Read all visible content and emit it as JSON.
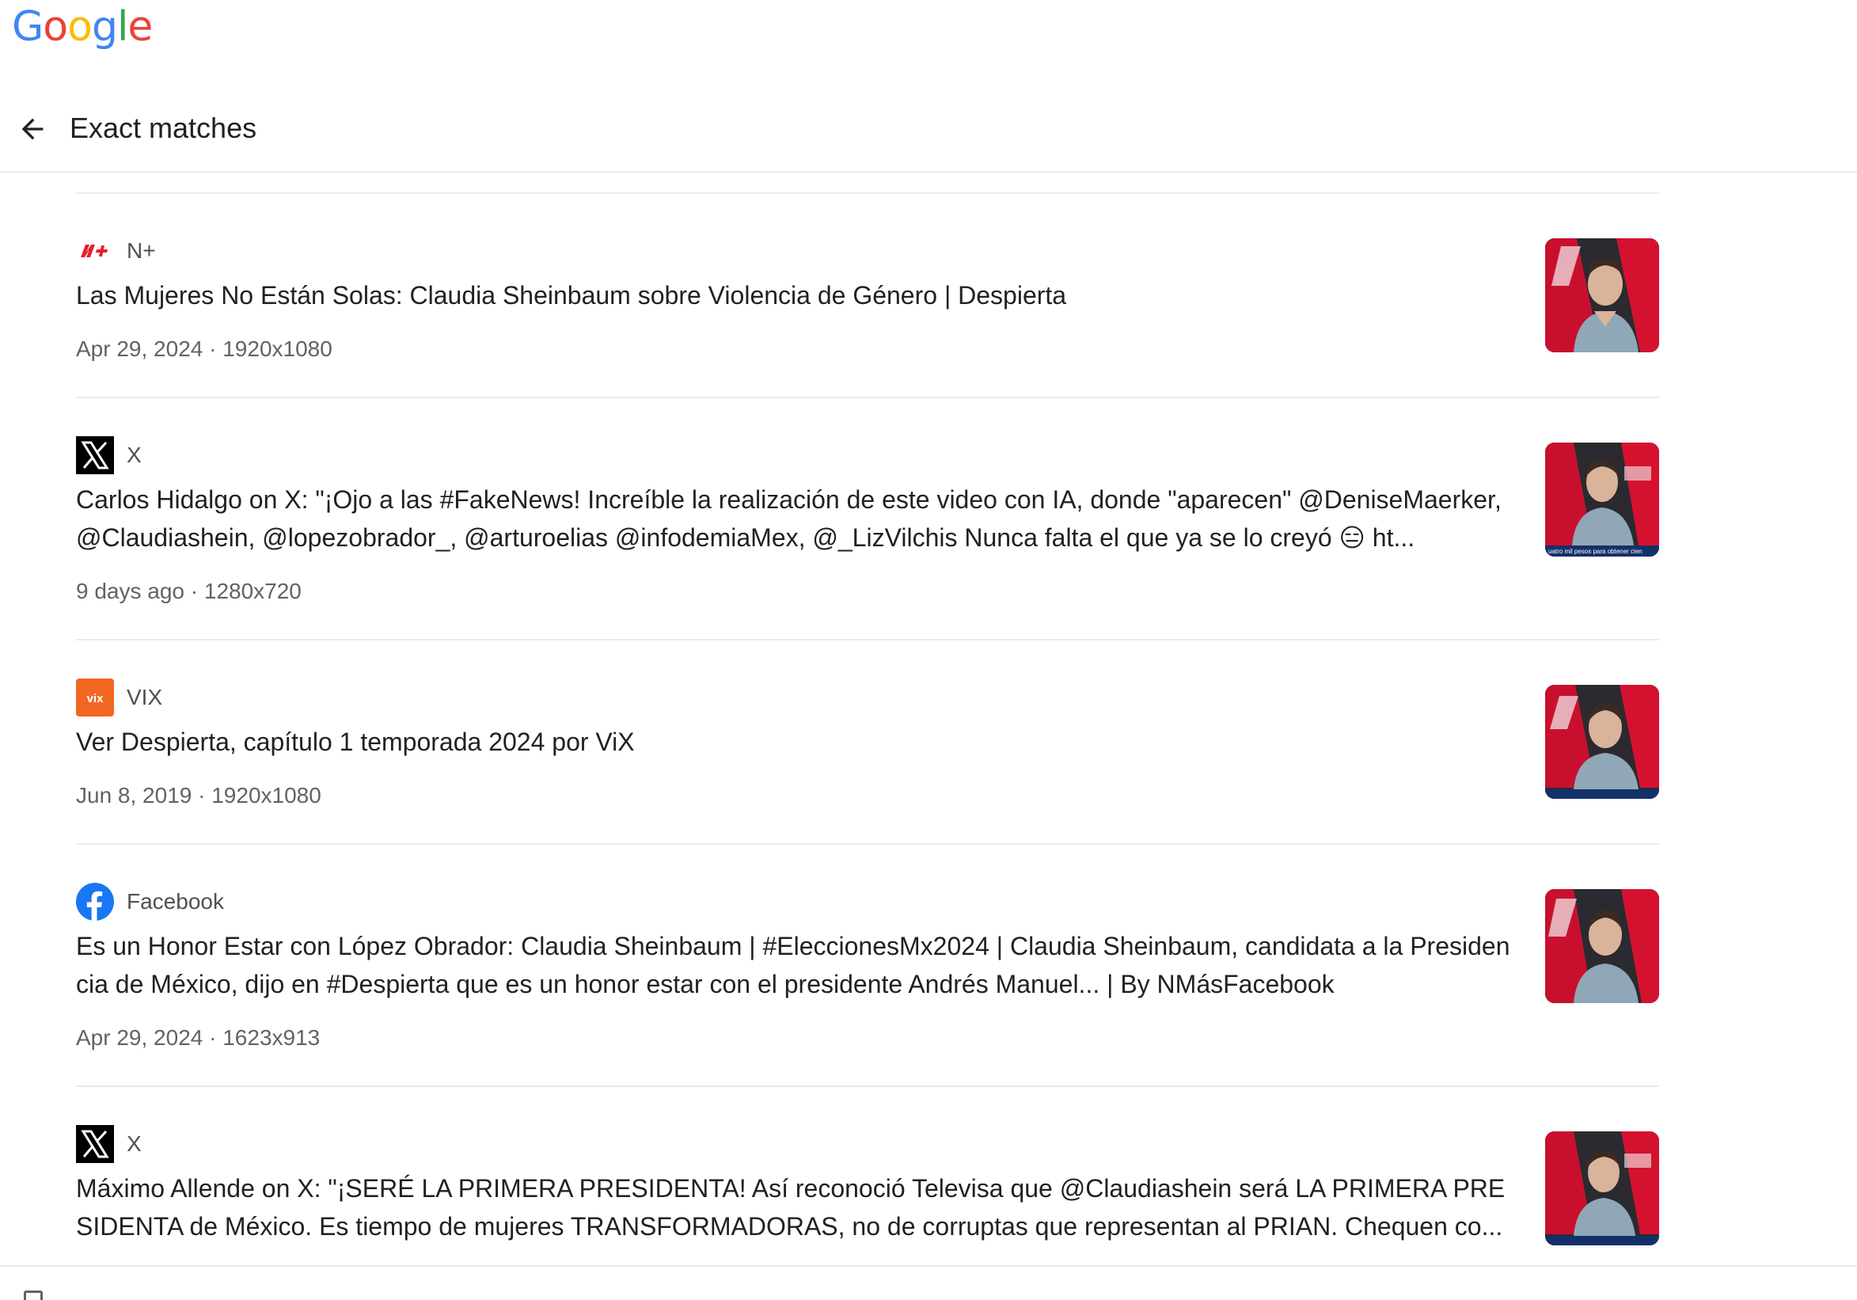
{
  "brand": {
    "logo_letters": [
      "G",
      "o",
      "o",
      "g",
      "l",
      "e"
    ],
    "logo_colors": [
      "#4285F4",
      "#EA4335",
      "#FBBC05",
      "#4285F4",
      "#34A853",
      "#EA4335"
    ]
  },
  "header": {
    "title": "Exact matches",
    "back_icon": "arrow-left-icon"
  },
  "results": [
    {
      "source": "N+",
      "source_icon": "nmas-logo-icon",
      "title": "Las Mujeres No Están Solas: Claudia Sheinbaum sobre Violencia de Género | Despierta",
      "meta": "Apr 29, 2024 · 1920x1080",
      "thumbnail_caption": ""
    },
    {
      "source": "X",
      "source_icon": "x-logo-icon",
      "title": "Carlos Hidalgo on X: \"¡Ojo a las #FakeNews! Increíble la realización de este video con IA, donde \"aparecen\" @DeniseMaerker, @Claudiashein, @lopezobrador_, @arturoelias @infodemiaMex, @_LizVilchis Nunca falta el que ya se lo creyó 😑 ht...",
      "meta": "9 days ago · 1280x720",
      "thumbnail_caption": "uatro mil pesos para obtener cien"
    },
    {
      "source": "VIX",
      "source_icon": "vix-logo-icon",
      "title": "Ver Despierta, capítulo 1 temporada 2024 por ViX",
      "meta": "Jun 8, 2019 · 1920x1080",
      "thumbnail_caption": ""
    },
    {
      "source": "Facebook",
      "source_icon": "facebook-logo-icon",
      "title": "Es un Honor Estar con López Obrador: Claudia Sheinbaum | #EleccionesMx2024 | Claudia Sheinbaum, candidata a la Presidencia de México, dijo en #Despierta que es un honor estar con el presidente Andrés Manuel... | By NMásFacebook",
      "meta": "Apr 29, 2024 · 1623x913",
      "thumbnail_caption": ""
    },
    {
      "source": "X",
      "source_icon": "x-logo-icon",
      "title": "Máximo Allende on X: \"¡SERÉ LA PRIMERA PRESIDENTA! Así reconoció Televisa que @Claudiashein será LA PRIMERA PRESIDENTA de México. Es tiempo de mujeres TRANSFORMADORAS, no de corruptas que representan al PRIAN. Chequen co...",
      "meta": "",
      "thumbnail_caption": ""
    }
  ],
  "colors": {
    "divider": "#e8eaed",
    "meta_text": "#5f6368",
    "title_text": "#202124",
    "nmas_red": "#e4202f",
    "vix_orange": "#f26722",
    "facebook_blue": "#1877F2"
  }
}
